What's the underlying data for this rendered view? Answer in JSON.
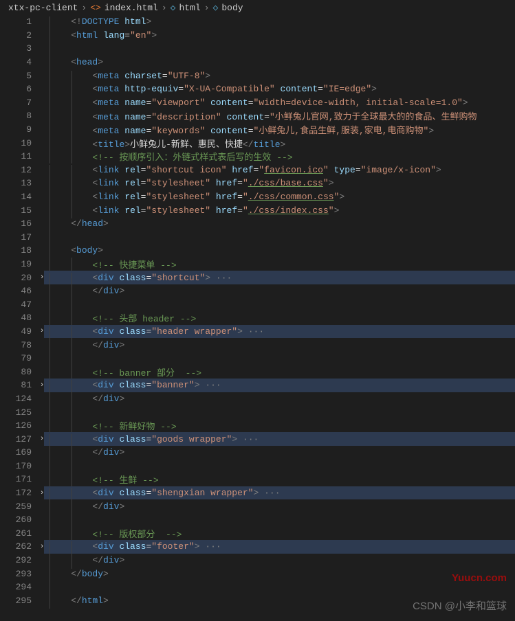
{
  "breadcrumb": {
    "items": [
      "xtx-pc-client",
      "index.html",
      "html",
      "body"
    ]
  },
  "lines": [
    {
      "num": 1,
      "hl": false,
      "fold": "",
      "indent": 1,
      "tokens": [
        [
          "grey",
          "<!"
        ],
        [
          "blue",
          "DOCTYPE"
        ],
        [
          "white",
          " "
        ],
        [
          "lblue",
          "html"
        ],
        [
          "grey",
          ">"
        ]
      ]
    },
    {
      "num": 2,
      "hl": false,
      "fold": "",
      "indent": 1,
      "tokens": [
        [
          "grey",
          "<"
        ],
        [
          "blue",
          "html"
        ],
        [
          "white",
          " "
        ],
        [
          "lblue",
          "lang"
        ],
        [
          "white",
          "="
        ],
        [
          "str",
          "\"en\""
        ],
        [
          "grey",
          ">"
        ]
      ]
    },
    {
      "num": 3,
      "hl": false,
      "fold": "",
      "indent": 1,
      "tokens": []
    },
    {
      "num": 4,
      "hl": false,
      "fold": "",
      "indent": 1,
      "tokens": [
        [
          "grey",
          "<"
        ],
        [
          "blue",
          "head"
        ],
        [
          "grey",
          ">"
        ]
      ]
    },
    {
      "num": 5,
      "hl": false,
      "fold": "",
      "indent": 2,
      "tokens": [
        [
          "grey",
          "<"
        ],
        [
          "blue",
          "meta"
        ],
        [
          "white",
          " "
        ],
        [
          "lblue",
          "charset"
        ],
        [
          "white",
          "="
        ],
        [
          "str",
          "\"UTF-8\""
        ],
        [
          "grey",
          ">"
        ]
      ]
    },
    {
      "num": 6,
      "hl": false,
      "fold": "",
      "indent": 2,
      "tokens": [
        [
          "grey",
          "<"
        ],
        [
          "blue",
          "meta"
        ],
        [
          "white",
          " "
        ],
        [
          "lblue",
          "http-equiv"
        ],
        [
          "white",
          "="
        ],
        [
          "str",
          "\"X-UA-Compatible\""
        ],
        [
          "white",
          " "
        ],
        [
          "lblue",
          "content"
        ],
        [
          "white",
          "="
        ],
        [
          "str",
          "\"IE=edge\""
        ],
        [
          "grey",
          ">"
        ]
      ]
    },
    {
      "num": 7,
      "hl": false,
      "fold": "",
      "indent": 2,
      "tokens": [
        [
          "grey",
          "<"
        ],
        [
          "blue",
          "meta"
        ],
        [
          "white",
          " "
        ],
        [
          "lblue",
          "name"
        ],
        [
          "white",
          "="
        ],
        [
          "str",
          "\"viewport\""
        ],
        [
          "white",
          " "
        ],
        [
          "lblue",
          "content"
        ],
        [
          "white",
          "="
        ],
        [
          "str",
          "\"width=device-width, initial-scale=1.0\""
        ],
        [
          "grey",
          ">"
        ]
      ]
    },
    {
      "num": 8,
      "hl": false,
      "fold": "",
      "indent": 2,
      "tokens": [
        [
          "grey",
          "<"
        ],
        [
          "blue",
          "meta"
        ],
        [
          "white",
          " "
        ],
        [
          "lblue",
          "name"
        ],
        [
          "white",
          "="
        ],
        [
          "str",
          "\"description\""
        ],
        [
          "white",
          " "
        ],
        [
          "lblue",
          "content"
        ],
        [
          "white",
          "="
        ],
        [
          "str",
          "\"小鲜兔儿官网,致力于全球最大的的食品、生鲜购物"
        ]
      ]
    },
    {
      "num": 9,
      "hl": false,
      "fold": "",
      "indent": 2,
      "tokens": [
        [
          "grey",
          "<"
        ],
        [
          "blue",
          "meta"
        ],
        [
          "white",
          " "
        ],
        [
          "lblue",
          "name"
        ],
        [
          "white",
          "="
        ],
        [
          "str",
          "\"keywords\""
        ],
        [
          "white",
          " "
        ],
        [
          "lblue",
          "content"
        ],
        [
          "white",
          "="
        ],
        [
          "str",
          "\"小鲜兔儿,食品生鲜,服装,家电,电商购物\""
        ],
        [
          "grey",
          ">"
        ]
      ]
    },
    {
      "num": 10,
      "hl": false,
      "fold": "",
      "indent": 2,
      "tokens": [
        [
          "grey",
          "<"
        ],
        [
          "blue",
          "title"
        ],
        [
          "grey",
          ">"
        ],
        [
          "white",
          "小鲜兔儿-新鲜、惠民、快捷"
        ],
        [
          "grey",
          "</"
        ],
        [
          "blue",
          "title"
        ],
        [
          "grey",
          ">"
        ]
      ]
    },
    {
      "num": 11,
      "hl": false,
      "fold": "",
      "indent": 2,
      "tokens": [
        [
          "green",
          "<!-- 按顺序引入：外链式样式表后写的生效 -->"
        ]
      ]
    },
    {
      "num": 12,
      "hl": false,
      "fold": "",
      "indent": 2,
      "tokens": [
        [
          "grey",
          "<"
        ],
        [
          "blue",
          "link"
        ],
        [
          "white",
          " "
        ],
        [
          "lblue",
          "rel"
        ],
        [
          "white",
          "="
        ],
        [
          "str",
          "\"shortcut icon\""
        ],
        [
          "white",
          " "
        ],
        [
          "lblue",
          "href"
        ],
        [
          "white",
          "="
        ],
        [
          "str",
          "\""
        ],
        [
          "str link",
          "favicon.ico"
        ],
        [
          "str",
          "\""
        ],
        [
          "white",
          " "
        ],
        [
          "lblue",
          "type"
        ],
        [
          "white",
          "="
        ],
        [
          "str",
          "\"image/x-icon\""
        ],
        [
          "grey",
          ">"
        ]
      ]
    },
    {
      "num": 13,
      "hl": false,
      "fold": "",
      "indent": 2,
      "tokens": [
        [
          "grey",
          "<"
        ],
        [
          "blue",
          "link"
        ],
        [
          "white",
          " "
        ],
        [
          "lblue",
          "rel"
        ],
        [
          "white",
          "="
        ],
        [
          "str",
          "\"stylesheet\""
        ],
        [
          "white",
          " "
        ],
        [
          "lblue",
          "href"
        ],
        [
          "white",
          "="
        ],
        [
          "str",
          "\""
        ],
        [
          "str link",
          "./css/base.css"
        ],
        [
          "str",
          "\""
        ],
        [
          "grey",
          ">"
        ]
      ]
    },
    {
      "num": 14,
      "hl": false,
      "fold": "",
      "indent": 2,
      "tokens": [
        [
          "grey",
          "<"
        ],
        [
          "blue",
          "link"
        ],
        [
          "white",
          " "
        ],
        [
          "lblue",
          "rel"
        ],
        [
          "white",
          "="
        ],
        [
          "str",
          "\"stylesheet\""
        ],
        [
          "white",
          " "
        ],
        [
          "lblue",
          "href"
        ],
        [
          "white",
          "="
        ],
        [
          "str",
          "\""
        ],
        [
          "str link",
          "./css/common.css"
        ],
        [
          "str",
          "\""
        ],
        [
          "grey",
          ">"
        ]
      ]
    },
    {
      "num": 15,
      "hl": false,
      "fold": "",
      "indent": 2,
      "tokens": [
        [
          "grey",
          "<"
        ],
        [
          "blue",
          "link"
        ],
        [
          "white",
          " "
        ],
        [
          "lblue",
          "rel"
        ],
        [
          "white",
          "="
        ],
        [
          "str",
          "\"stylesheet\""
        ],
        [
          "white",
          " "
        ],
        [
          "lblue",
          "href"
        ],
        [
          "white",
          "="
        ],
        [
          "str",
          "\""
        ],
        [
          "str link",
          "./css/index.css"
        ],
        [
          "str",
          "\""
        ],
        [
          "grey",
          ">"
        ]
      ]
    },
    {
      "num": 16,
      "hl": false,
      "fold": "",
      "indent": 1,
      "tokens": [
        [
          "grey",
          "</"
        ],
        [
          "blue",
          "head"
        ],
        [
          "grey",
          ">"
        ]
      ]
    },
    {
      "num": 17,
      "hl": false,
      "fold": "",
      "indent": 1,
      "tokens": []
    },
    {
      "num": 18,
      "hl": false,
      "fold": "",
      "indent": 1,
      "tokens": [
        [
          "grey",
          "<"
        ],
        [
          "blue",
          "body"
        ],
        [
          "grey",
          ">"
        ]
      ]
    },
    {
      "num": 19,
      "hl": false,
      "fold": "",
      "indent": 2,
      "tokens": [
        [
          "green",
          "<!-- 快捷菜单 -->"
        ]
      ]
    },
    {
      "num": 20,
      "hl": true,
      "fold": ">",
      "indent": 2,
      "tokens": [
        [
          "grey",
          "<"
        ],
        [
          "blue",
          "div"
        ],
        [
          "white",
          " "
        ],
        [
          "lblue",
          "class"
        ],
        [
          "white",
          "="
        ],
        [
          "str",
          "\"shortcut\""
        ],
        [
          "grey",
          ">"
        ],
        [
          "grey",
          " ···"
        ]
      ]
    },
    {
      "num": 46,
      "hl": false,
      "fold": "",
      "indent": 2,
      "tokens": [
        [
          "grey",
          "</"
        ],
        [
          "blue",
          "div"
        ],
        [
          "grey",
          ">"
        ]
      ]
    },
    {
      "num": 47,
      "hl": false,
      "fold": "",
      "indent": 2,
      "tokens": []
    },
    {
      "num": 48,
      "hl": false,
      "fold": "",
      "indent": 2,
      "tokens": [
        [
          "green",
          "<!-- 头部 header -->"
        ]
      ]
    },
    {
      "num": 49,
      "hl": true,
      "fold": ">",
      "indent": 2,
      "tokens": [
        [
          "grey",
          "<"
        ],
        [
          "blue",
          "div"
        ],
        [
          "white",
          " "
        ],
        [
          "lblue",
          "class"
        ],
        [
          "white",
          "="
        ],
        [
          "str",
          "\"header wrapper\""
        ],
        [
          "grey",
          ">"
        ],
        [
          "grey",
          " ···"
        ]
      ]
    },
    {
      "num": 78,
      "hl": false,
      "fold": "",
      "indent": 2,
      "tokens": [
        [
          "grey",
          "</"
        ],
        [
          "blue",
          "div"
        ],
        [
          "grey",
          ">"
        ]
      ]
    },
    {
      "num": 79,
      "hl": false,
      "fold": "",
      "indent": 2,
      "tokens": []
    },
    {
      "num": 80,
      "hl": false,
      "fold": "",
      "indent": 2,
      "tokens": [
        [
          "green",
          "<!-- banner 部分  -->"
        ]
      ]
    },
    {
      "num": 81,
      "hl": true,
      "fold": ">",
      "indent": 2,
      "tokens": [
        [
          "grey",
          "<"
        ],
        [
          "blue",
          "div"
        ],
        [
          "white",
          " "
        ],
        [
          "lblue",
          "class"
        ],
        [
          "white",
          "="
        ],
        [
          "str",
          "\"banner\""
        ],
        [
          "grey",
          ">"
        ],
        [
          "grey",
          " ···"
        ]
      ]
    },
    {
      "num": 124,
      "hl": false,
      "fold": "",
      "indent": 2,
      "tokens": [
        [
          "grey",
          "</"
        ],
        [
          "blue",
          "div"
        ],
        [
          "grey",
          ">"
        ]
      ]
    },
    {
      "num": 125,
      "hl": false,
      "fold": "",
      "indent": 2,
      "tokens": []
    },
    {
      "num": 126,
      "hl": false,
      "fold": "",
      "indent": 2,
      "tokens": [
        [
          "green",
          "<!-- 新鲜好物 -->"
        ]
      ]
    },
    {
      "num": 127,
      "hl": true,
      "fold": ">",
      "indent": 2,
      "tokens": [
        [
          "grey",
          "<"
        ],
        [
          "blue",
          "div"
        ],
        [
          "white",
          " "
        ],
        [
          "lblue",
          "class"
        ],
        [
          "white",
          "="
        ],
        [
          "str",
          "\"goods wrapper\""
        ],
        [
          "grey",
          ">"
        ],
        [
          "grey",
          " ···"
        ]
      ]
    },
    {
      "num": 169,
      "hl": false,
      "fold": "",
      "indent": 2,
      "tokens": [
        [
          "grey",
          "</"
        ],
        [
          "blue",
          "div"
        ],
        [
          "grey",
          ">"
        ]
      ]
    },
    {
      "num": 170,
      "hl": false,
      "fold": "",
      "indent": 2,
      "tokens": []
    },
    {
      "num": 171,
      "hl": false,
      "fold": "",
      "indent": 2,
      "tokens": [
        [
          "green",
          "<!-- 生鲜 -->"
        ]
      ]
    },
    {
      "num": 172,
      "hl": true,
      "fold": ">",
      "indent": 2,
      "tokens": [
        [
          "grey",
          "<"
        ],
        [
          "blue",
          "div"
        ],
        [
          "white",
          " "
        ],
        [
          "lblue",
          "class"
        ],
        [
          "white",
          "="
        ],
        [
          "str",
          "\"shengxian wrapper\""
        ],
        [
          "grey",
          ">"
        ],
        [
          "grey",
          " ···"
        ]
      ]
    },
    {
      "num": 259,
      "hl": false,
      "fold": "",
      "indent": 2,
      "tokens": [
        [
          "grey",
          "</"
        ],
        [
          "blue",
          "div"
        ],
        [
          "grey",
          ">"
        ]
      ]
    },
    {
      "num": 260,
      "hl": false,
      "fold": "",
      "indent": 2,
      "tokens": []
    },
    {
      "num": 261,
      "hl": false,
      "fold": "",
      "indent": 2,
      "tokens": [
        [
          "green",
          "<!-- 版权部分  -->"
        ]
      ]
    },
    {
      "num": 262,
      "hl": true,
      "fold": ">",
      "indent": 2,
      "tokens": [
        [
          "grey",
          "<"
        ],
        [
          "blue",
          "div"
        ],
        [
          "white",
          " "
        ],
        [
          "lblue",
          "class"
        ],
        [
          "white",
          "="
        ],
        [
          "str",
          "\"footer\""
        ],
        [
          "grey",
          ">"
        ],
        [
          "grey",
          " ···"
        ]
      ]
    },
    {
      "num": 292,
      "hl": false,
      "fold": "",
      "indent": 2,
      "tokens": [
        [
          "grey",
          "</"
        ],
        [
          "blue",
          "div"
        ],
        [
          "grey",
          ">"
        ]
      ]
    },
    {
      "num": 293,
      "hl": false,
      "fold": "",
      "indent": 1,
      "tokens": [
        [
          "grey",
          "</"
        ],
        [
          "blue",
          "body"
        ],
        [
          "grey",
          ">"
        ]
      ]
    },
    {
      "num": 294,
      "hl": false,
      "fold": "",
      "indent": 1,
      "tokens": []
    },
    {
      "num": 295,
      "hl": false,
      "fold": "",
      "indent": 1,
      "tokens": [
        [
          "grey",
          "</"
        ],
        [
          "blue",
          "html"
        ],
        [
          "grey",
          ">"
        ]
      ]
    }
  ],
  "watermarks": {
    "w1": "Yuucn.com",
    "w2": "CSDN @小李和篮球"
  }
}
